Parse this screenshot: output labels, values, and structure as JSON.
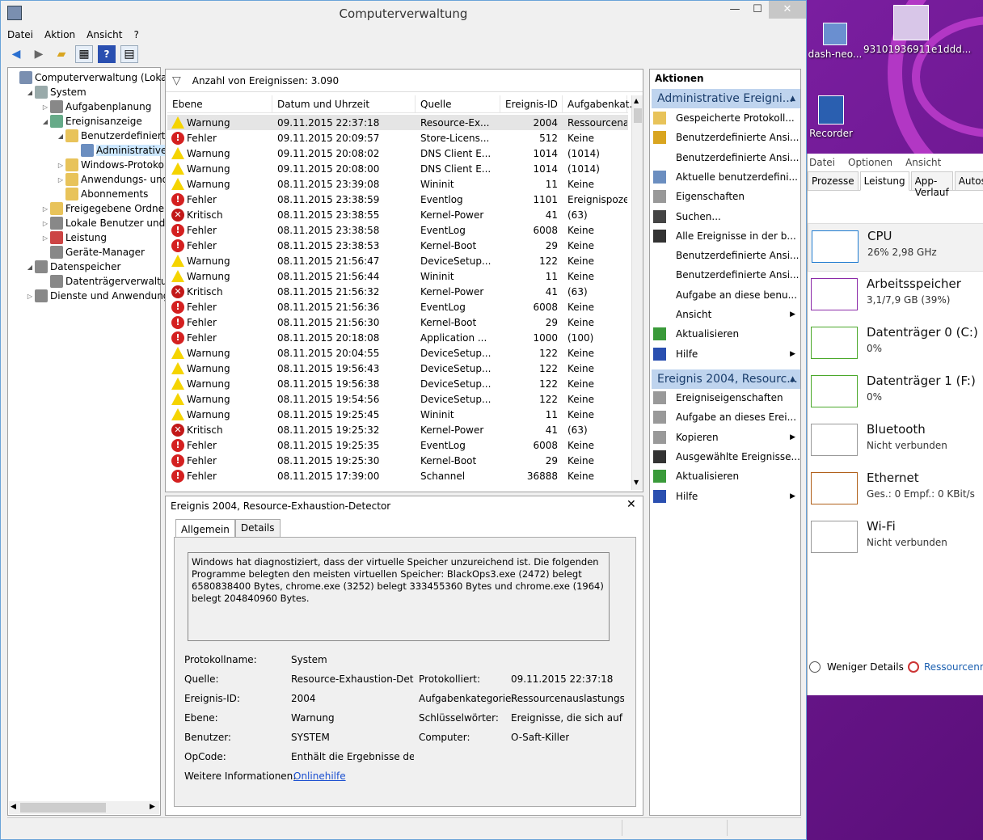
{
  "window": {
    "title": "Computerverwaltung",
    "minimize": "—",
    "maximize": "☐",
    "close": "✕"
  },
  "menu": [
    "Datei",
    "Aktion",
    "Ansicht",
    "?"
  ],
  "tree": [
    {
      "label": "Computerverwaltung (Lokal)",
      "depth": 0,
      "exp": "",
      "icon": "#7a8fb0"
    },
    {
      "label": "System",
      "depth": 1,
      "exp": "◢",
      "icon": "#9aa"
    },
    {
      "label": "Aufgabenplanung",
      "depth": 2,
      "exp": "▷",
      "icon": "#888"
    },
    {
      "label": "Ereignisanzeige",
      "depth": 2,
      "exp": "◢",
      "icon": "#6a8"
    },
    {
      "label": "Benutzerdefinierte A",
      "depth": 3,
      "exp": "◢",
      "icon": "#e8c35a"
    },
    {
      "label": "Administrative E",
      "depth": 4,
      "exp": "",
      "icon": "#6b8ec0",
      "selected": true
    },
    {
      "label": "Windows-Protokolle",
      "depth": 3,
      "exp": "▷",
      "icon": "#e8c35a"
    },
    {
      "label": "Anwendungs- und D",
      "depth": 3,
      "exp": "▷",
      "icon": "#e8c35a"
    },
    {
      "label": "Abonnements",
      "depth": 3,
      "exp": "",
      "icon": "#e8c35a"
    },
    {
      "label": "Freigegebene Ordner",
      "depth": 2,
      "exp": "▷",
      "icon": "#e8c35a"
    },
    {
      "label": "Lokale Benutzer und Gr",
      "depth": 2,
      "exp": "▷",
      "icon": "#888"
    },
    {
      "label": "Leistung",
      "depth": 2,
      "exp": "▷",
      "icon": "#c44"
    },
    {
      "label": "Geräte-Manager",
      "depth": 2,
      "exp": "",
      "icon": "#888"
    },
    {
      "label": "Datenspeicher",
      "depth": 1,
      "exp": "◢",
      "icon": "#888"
    },
    {
      "label": "Datenträgerverwaltung",
      "depth": 2,
      "exp": "",
      "icon": "#888"
    },
    {
      "label": "Dienste und Anwendungen",
      "depth": 1,
      "exp": "▷",
      "icon": "#888"
    }
  ],
  "list": {
    "count_label": "Anzahl von Ereignissen: 3.090",
    "columns": [
      "Ebene",
      "Datum und Uhrzeit",
      "Quelle",
      "Ereignis-ID",
      "Aufgabenkat..."
    ],
    "rows": [
      [
        "warn",
        "Warnung",
        "09.11.2015 22:37:18",
        "Resource-Ex...",
        "2004",
        "Ressourcena..."
      ],
      [
        "err",
        "Fehler",
        "09.11.2015 20:09:57",
        "Store-Licens...",
        "512",
        "Keine"
      ],
      [
        "warn",
        "Warnung",
        "09.11.2015 20:08:02",
        "DNS Client E...",
        "1014",
        "(1014)"
      ],
      [
        "warn",
        "Warnung",
        "09.11.2015 20:08:00",
        "DNS Client E...",
        "1014",
        "(1014)"
      ],
      [
        "warn",
        "Warnung",
        "08.11.2015 23:39:08",
        "Wininit",
        "11",
        "Keine"
      ],
      [
        "err",
        "Fehler",
        "08.11.2015 23:38:59",
        "Eventlog",
        "1101",
        "Ereignispoze..."
      ],
      [
        "crit",
        "Kritisch",
        "08.11.2015 23:38:55",
        "Kernel-Power",
        "41",
        "(63)"
      ],
      [
        "err",
        "Fehler",
        "08.11.2015 23:38:58",
        "EventLog",
        "6008",
        "Keine"
      ],
      [
        "err",
        "Fehler",
        "08.11.2015 23:38:53",
        "Kernel-Boot",
        "29",
        "Keine"
      ],
      [
        "warn",
        "Warnung",
        "08.11.2015 21:56:47",
        "DeviceSetup...",
        "122",
        "Keine"
      ],
      [
        "warn",
        "Warnung",
        "08.11.2015 21:56:44",
        "Wininit",
        "11",
        "Keine"
      ],
      [
        "crit",
        "Kritisch",
        "08.11.2015 21:56:32",
        "Kernel-Power",
        "41",
        "(63)"
      ],
      [
        "err",
        "Fehler",
        "08.11.2015 21:56:36",
        "EventLog",
        "6008",
        "Keine"
      ],
      [
        "err",
        "Fehler",
        "08.11.2015 21:56:30",
        "Kernel-Boot",
        "29",
        "Keine"
      ],
      [
        "err",
        "Fehler",
        "08.11.2015 20:18:08",
        "Application ...",
        "1000",
        "(100)"
      ],
      [
        "warn",
        "Warnung",
        "08.11.2015 20:04:55",
        "DeviceSetup...",
        "122",
        "Keine"
      ],
      [
        "warn",
        "Warnung",
        "08.11.2015 19:56:43",
        "DeviceSetup...",
        "122",
        "Keine"
      ],
      [
        "warn",
        "Warnung",
        "08.11.2015 19:56:38",
        "DeviceSetup...",
        "122",
        "Keine"
      ],
      [
        "warn",
        "Warnung",
        "08.11.2015 19:54:56",
        "DeviceSetup...",
        "122",
        "Keine"
      ],
      [
        "warn",
        "Warnung",
        "08.11.2015 19:25:45",
        "Wininit",
        "11",
        "Keine"
      ],
      [
        "crit",
        "Kritisch",
        "08.11.2015 19:25:32",
        "Kernel-Power",
        "41",
        "(63)"
      ],
      [
        "err",
        "Fehler",
        "08.11.2015 19:25:35",
        "EventLog",
        "6008",
        "Keine"
      ],
      [
        "err",
        "Fehler",
        "08.11.2015 19:25:30",
        "Kernel-Boot",
        "29",
        "Keine"
      ],
      [
        "err",
        "Fehler",
        "08.11.2015 17:39:00",
        "Schannel",
        "36888",
        "Keine"
      ]
    ]
  },
  "detail": {
    "header": "Ereignis 2004, Resource-Exhaustion-Detector",
    "tabs": [
      "Allgemein",
      "Details"
    ],
    "message": "Windows hat diagnostiziert, dass der virtuelle Speicher unzureichend ist. Die folgenden Programme belegten den meisten virtuellen Speicher: BlackOps3.exe (2472) belegt 6580838400 Bytes, chrome.exe (3252) belegt 333455360 Bytes und chrome.exe (1964) belegt 204840960 Bytes.",
    "props": {
      "protokollname_label": "Protokollname:",
      "protokollname": "System",
      "quelle_label": "Quelle:",
      "quelle": "Resource-Exhaustion-Detect",
      "protokolliert_label": "Protokolliert:",
      "protokolliert": "09.11.2015 22:37:18",
      "id_label": "Ereignis-ID:",
      "id": "2004",
      "kategorie_label": "Aufgabenkategorie:",
      "kategorie": "Ressourcenauslastungsd",
      "ebene_label": "Ebene:",
      "ebene": "Warnung",
      "schluessel_label": "Schlüsselwörter:",
      "schluessel": "Ereignisse, die sich auf d",
      "benutzer_label": "Benutzer:",
      "benutzer": "SYSTEM",
      "computer_label": "Computer:",
      "computer": "O-Saft-Killer",
      "opcode_label": "OpCode:",
      "opcode": "Enthält die Ergebnisse der Di",
      "info_label": "Weitere Informationen:",
      "info_link": "Onlinehilfe"
    }
  },
  "actions": {
    "title": "Aktionen",
    "section1": "Administrative Ereigni...",
    "items1": [
      {
        "label": "Gespeicherte Protokoll...",
        "icon": "#e8c35a",
        "arrow": false
      },
      {
        "label": "Benutzerdefinierte Ansi...",
        "icon": "#d9a520",
        "arrow": false
      },
      {
        "label": "Benutzerdefinierte Ansi...",
        "icon": "",
        "arrow": false
      },
      {
        "label": "Aktuelle benutzerdefini...",
        "icon": "#6b8ec0",
        "arrow": false
      },
      {
        "label": "Eigenschaften",
        "icon": "#999",
        "arrow": false
      },
      {
        "label": "Suchen...",
        "icon": "#444",
        "arrow": false
      },
      {
        "label": "Alle Ereignisse in der b...",
        "icon": "#333",
        "arrow": false
      },
      {
        "label": "Benutzerdefinierte Ansi...",
        "icon": "",
        "arrow": false
      },
      {
        "label": "Benutzerdefinierte Ansi...",
        "icon": "",
        "arrow": false
      },
      {
        "label": "Aufgabe an diese benu...",
        "icon": "",
        "arrow": false
      },
      {
        "label": "Ansicht",
        "icon": "",
        "arrow": true
      },
      {
        "label": "Aktualisieren",
        "icon": "#3a9a3a",
        "arrow": false
      },
      {
        "label": "Hilfe",
        "icon": "#2a4fb0",
        "arrow": true
      }
    ],
    "section2": "Ereignis 2004, Resourc...",
    "items2": [
      {
        "label": "Ereigniseigenschaften",
        "icon": "#999",
        "arrow": false
      },
      {
        "label": "Aufgabe an dieses Erei...",
        "icon": "#999",
        "arrow": false
      },
      {
        "label": "Kopieren",
        "icon": "#999",
        "arrow": true
      },
      {
        "label": "Ausgewählte Ereignisse...",
        "icon": "#333",
        "arrow": false
      },
      {
        "label": "Aktualisieren",
        "icon": "#3a9a3a",
        "arrow": false
      },
      {
        "label": "Hilfe",
        "icon": "#2a4fb0",
        "arrow": true
      }
    ]
  },
  "desktop": {
    "icon1": "dash-neo...",
    "icon2": "93101936911e1ddd...",
    "icon3": "Recorder"
  },
  "taskmanager": {
    "menu": [
      "Datei",
      "Optionen",
      "Ansicht"
    ],
    "tabs": [
      "Prozesse",
      "Leistung",
      "App-Verlauf",
      "Autos"
    ],
    "active_tab": "Leistung",
    "items": [
      {
        "name": "CPU",
        "detail": "26%  2,98 GHz",
        "color": "#1e7bd0"
      },
      {
        "name": "Arbeitsspeicher",
        "detail": "3,1/7,9 GB (39%)",
        "color": "#8b2aa8"
      },
      {
        "name": "Datenträger 0 (C:)",
        "detail": "0%",
        "color": "#4aa82a"
      },
      {
        "name": "Datenträger 1 (F:)",
        "detail": "0%",
        "color": "#4aa82a"
      },
      {
        "name": "Bluetooth",
        "detail": "Nicht verbunden",
        "color": "#999999"
      },
      {
        "name": "Ethernet",
        "detail": "Ges.: 0  Empf.: 0 KBit/s",
        "color": "#b0601a"
      },
      {
        "name": "Wi-Fi",
        "detail": "Nicht verbunden",
        "color": "#999999"
      }
    ],
    "fewer_details": "Weniger Details",
    "resource_monitor": "Ressourcenmo"
  }
}
